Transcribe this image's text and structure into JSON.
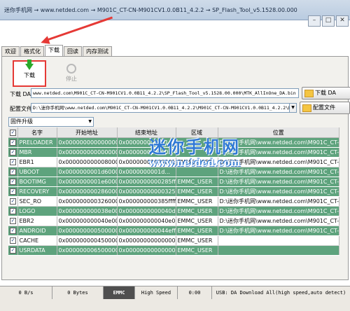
{
  "window": {
    "title": "迷你手机网 → www.netded.com → M901C_CT-CN-M901CV1.0.0B11_4.2.2 → SP_Flash_Tool_v5.1528.00.000"
  },
  "tabs": [
    "欢迎",
    "格式化",
    "下载",
    "回读",
    "内存测试"
  ],
  "active_tab": 2,
  "toolbar": {
    "download_label": "下载",
    "stop_label": "停止"
  },
  "download_agent": {
    "label": "下载 DA",
    "value": "www.netded.com\\M901C_CT-CN-M901CV1.0.0B11_4.2.2\\SP_Flash_Tool_v5.1528.00.000\\MTK_AllInOne_DA.bin",
    "button": "下载 DA"
  },
  "scatter": {
    "label": "配置文件",
    "value": "D:\\迷你手机网\\www.netded.com\\M901C_CT-CN-M901CV1.0.0B11_4.2.2\\M901C_CT-CN-M901CV1.0.0B11_4.2.2\\MT6592",
    "button": "配置文件"
  },
  "mode": {
    "value": "固件升级"
  },
  "table": {
    "headers": [
      "",
      "名字",
      "开始地址",
      "结束地址",
      "区域",
      "位置"
    ],
    "rows": [
      {
        "name": "PRELOADER",
        "start": "0x0000000000000000",
        "end": "0x000000000001...",
        "region": "",
        "location": "D:\\迷你手机网\\www.netded.com\\M901C_CT-C...",
        "color": "green"
      },
      {
        "name": "MBR",
        "start": "0x0000000000000000",
        "end": "0x000000000000...",
        "region": "",
        "location": "D:\\迷你手机网\\www.netded.com\\M901C_CT-C...",
        "color": "green"
      },
      {
        "name": "EBR1",
        "start": "0x0000000000080000",
        "end": "0x00000000000801ff",
        "region": "EMMC_USER",
        "location": "D:\\迷你手机网\\www.netded.com\\M901C_CT-C...",
        "color": "white"
      },
      {
        "name": "UBOOT",
        "start": "0x0000000001d60000",
        "end": "0x0000000001d...",
        "region": "",
        "location": "D:\\迷你手机网\\www.netded.com\\M901C_CT-C...",
        "color": "green"
      },
      {
        "name": "BOOTIMG",
        "start": "0x0000000001e60000",
        "end": "0x0000000000285ffff",
        "region": "EMMC_USER",
        "location": "D:\\迷你手机网\\www.netded.com\\M901C_CT-C...",
        "color": "green"
      },
      {
        "name": "RECOVERY",
        "start": "0x0000000002860000",
        "end": "0x00000000000325ffff",
        "region": "EMMC_USER",
        "location": "D:\\迷你手机网\\www.netded.com\\M901C_CT-C...",
        "color": "green"
      },
      {
        "name": "SEC_RO",
        "start": "0x0000000003260000",
        "end": "0x000000000385ffff",
        "region": "EMMC_USER",
        "location": "D:\\迷你手机网\\www.netded.com\\M901C_CT-C...",
        "color": "white"
      },
      {
        "name": "LOGO",
        "start": "0x000000000038e0000",
        "end": "0x0000000000040dffff",
        "region": "EMMC_USER",
        "location": "D:\\迷你手机网\\www.netded.com\\M901C_CT-C...",
        "color": "green"
      },
      {
        "name": "EBR2",
        "start": "0x000000000040e0000",
        "end": "0x000000000040e01ff",
        "region": "EMMC_USER",
        "location": "D:\\迷你手机网\\www.netded.com\\M901C_CT-C...",
        "color": "white"
      },
      {
        "name": "ANDROID",
        "start": "0x0000000005000000",
        "end": "0x000000000044effff",
        "region": "EMMC_USER",
        "location": "D:\\迷你手机网\\www.netded.com\\M901C_CT-C...",
        "color": "green"
      },
      {
        "name": "CACHE",
        "start": "0x0000000004500000",
        "end": "0x000000000000000",
        "region": "EMMC_USER",
        "location": "",
        "color": "white"
      },
      {
        "name": "USRDATA",
        "start": "0x0000000065000000",
        "end": "0x000000000000000",
        "region": "EMMC_USER",
        "location": "",
        "color": "green"
      }
    ]
  },
  "watermark": {
    "line1": "迷你手机网",
    "line2": "www.netded.com"
  },
  "status": {
    "speed": "0 B/s",
    "bytes": "0 Bytes",
    "storage": "EMMC",
    "usb_speed": "High Speed",
    "time": "0:00",
    "info": "USB: DA Download All(high speed,auto detect)"
  },
  "colors": {
    "row_green": "#5ea37d",
    "highlight_red": "#e53935",
    "watermark_blue": "#2f79d4"
  }
}
